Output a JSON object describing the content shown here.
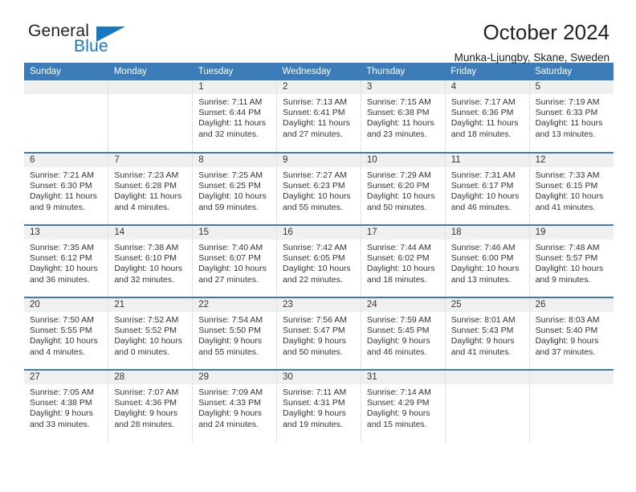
{
  "brand": {
    "name_part1": "General",
    "name_part2": "Blue",
    "logo_icon": "triangle-icon"
  },
  "header": {
    "title": "October 2024",
    "subtitle": "Munka-Ljungby, Skane, Sweden"
  },
  "colors": {
    "header_blue": "#3c7cb9",
    "brand_blue": "#1878be",
    "daynum_band": "#f0f0f0",
    "text": "#333333"
  },
  "weekdays": [
    "Sunday",
    "Monday",
    "Tuesday",
    "Wednesday",
    "Thursday",
    "Friday",
    "Saturday"
  ],
  "weeks": [
    [
      {
        "day": "",
        "lines": []
      },
      {
        "day": "",
        "lines": []
      },
      {
        "day": "1",
        "lines": [
          "Sunrise: 7:11 AM",
          "Sunset: 6:44 PM",
          "Daylight: 11 hours",
          "and 32 minutes."
        ]
      },
      {
        "day": "2",
        "lines": [
          "Sunrise: 7:13 AM",
          "Sunset: 6:41 PM",
          "Daylight: 11 hours",
          "and 27 minutes."
        ]
      },
      {
        "day": "3",
        "lines": [
          "Sunrise: 7:15 AM",
          "Sunset: 6:38 PM",
          "Daylight: 11 hours",
          "and 23 minutes."
        ]
      },
      {
        "day": "4",
        "lines": [
          "Sunrise: 7:17 AM",
          "Sunset: 6:36 PM",
          "Daylight: 11 hours",
          "and 18 minutes."
        ]
      },
      {
        "day": "5",
        "lines": [
          "Sunrise: 7:19 AM",
          "Sunset: 6:33 PM",
          "Daylight: 11 hours",
          "and 13 minutes."
        ]
      }
    ],
    [
      {
        "day": "6",
        "lines": [
          "Sunrise: 7:21 AM",
          "Sunset: 6:30 PM",
          "Daylight: 11 hours",
          "and 9 minutes."
        ]
      },
      {
        "day": "7",
        "lines": [
          "Sunrise: 7:23 AM",
          "Sunset: 6:28 PM",
          "Daylight: 11 hours",
          "and 4 minutes."
        ]
      },
      {
        "day": "8",
        "lines": [
          "Sunrise: 7:25 AM",
          "Sunset: 6:25 PM",
          "Daylight: 10 hours",
          "and 59 minutes."
        ]
      },
      {
        "day": "9",
        "lines": [
          "Sunrise: 7:27 AM",
          "Sunset: 6:23 PM",
          "Daylight: 10 hours",
          "and 55 minutes."
        ]
      },
      {
        "day": "10",
        "lines": [
          "Sunrise: 7:29 AM",
          "Sunset: 6:20 PM",
          "Daylight: 10 hours",
          "and 50 minutes."
        ]
      },
      {
        "day": "11",
        "lines": [
          "Sunrise: 7:31 AM",
          "Sunset: 6:17 PM",
          "Daylight: 10 hours",
          "and 46 minutes."
        ]
      },
      {
        "day": "12",
        "lines": [
          "Sunrise: 7:33 AM",
          "Sunset: 6:15 PM",
          "Daylight: 10 hours",
          "and 41 minutes."
        ]
      }
    ],
    [
      {
        "day": "13",
        "lines": [
          "Sunrise: 7:35 AM",
          "Sunset: 6:12 PM",
          "Daylight: 10 hours",
          "and 36 minutes."
        ]
      },
      {
        "day": "14",
        "lines": [
          "Sunrise: 7:38 AM",
          "Sunset: 6:10 PM",
          "Daylight: 10 hours",
          "and 32 minutes."
        ]
      },
      {
        "day": "15",
        "lines": [
          "Sunrise: 7:40 AM",
          "Sunset: 6:07 PM",
          "Daylight: 10 hours",
          "and 27 minutes."
        ]
      },
      {
        "day": "16",
        "lines": [
          "Sunrise: 7:42 AM",
          "Sunset: 6:05 PM",
          "Daylight: 10 hours",
          "and 22 minutes."
        ]
      },
      {
        "day": "17",
        "lines": [
          "Sunrise: 7:44 AM",
          "Sunset: 6:02 PM",
          "Daylight: 10 hours",
          "and 18 minutes."
        ]
      },
      {
        "day": "18",
        "lines": [
          "Sunrise: 7:46 AM",
          "Sunset: 6:00 PM",
          "Daylight: 10 hours",
          "and 13 minutes."
        ]
      },
      {
        "day": "19",
        "lines": [
          "Sunrise: 7:48 AM",
          "Sunset: 5:57 PM",
          "Daylight: 10 hours",
          "and 9 minutes."
        ]
      }
    ],
    [
      {
        "day": "20",
        "lines": [
          "Sunrise: 7:50 AM",
          "Sunset: 5:55 PM",
          "Daylight: 10 hours",
          "and 4 minutes."
        ]
      },
      {
        "day": "21",
        "lines": [
          "Sunrise: 7:52 AM",
          "Sunset: 5:52 PM",
          "Daylight: 10 hours",
          "and 0 minutes."
        ]
      },
      {
        "day": "22",
        "lines": [
          "Sunrise: 7:54 AM",
          "Sunset: 5:50 PM",
          "Daylight: 9 hours",
          "and 55 minutes."
        ]
      },
      {
        "day": "23",
        "lines": [
          "Sunrise: 7:56 AM",
          "Sunset: 5:47 PM",
          "Daylight: 9 hours",
          "and 50 minutes."
        ]
      },
      {
        "day": "24",
        "lines": [
          "Sunrise: 7:59 AM",
          "Sunset: 5:45 PM",
          "Daylight: 9 hours",
          "and 46 minutes."
        ]
      },
      {
        "day": "25",
        "lines": [
          "Sunrise: 8:01 AM",
          "Sunset: 5:43 PM",
          "Daylight: 9 hours",
          "and 41 minutes."
        ]
      },
      {
        "day": "26",
        "lines": [
          "Sunrise: 8:03 AM",
          "Sunset: 5:40 PM",
          "Daylight: 9 hours",
          "and 37 minutes."
        ]
      }
    ],
    [
      {
        "day": "27",
        "lines": [
          "Sunrise: 7:05 AM",
          "Sunset: 4:38 PM",
          "Daylight: 9 hours",
          "and 33 minutes."
        ]
      },
      {
        "day": "28",
        "lines": [
          "Sunrise: 7:07 AM",
          "Sunset: 4:36 PM",
          "Daylight: 9 hours",
          "and 28 minutes."
        ]
      },
      {
        "day": "29",
        "lines": [
          "Sunrise: 7:09 AM",
          "Sunset: 4:33 PM",
          "Daylight: 9 hours",
          "and 24 minutes."
        ]
      },
      {
        "day": "30",
        "lines": [
          "Sunrise: 7:11 AM",
          "Sunset: 4:31 PM",
          "Daylight: 9 hours",
          "and 19 minutes."
        ]
      },
      {
        "day": "31",
        "lines": [
          "Sunrise: 7:14 AM",
          "Sunset: 4:29 PM",
          "Daylight: 9 hours",
          "and 15 minutes."
        ]
      },
      {
        "day": "",
        "lines": []
      },
      {
        "day": "",
        "lines": []
      }
    ]
  ]
}
